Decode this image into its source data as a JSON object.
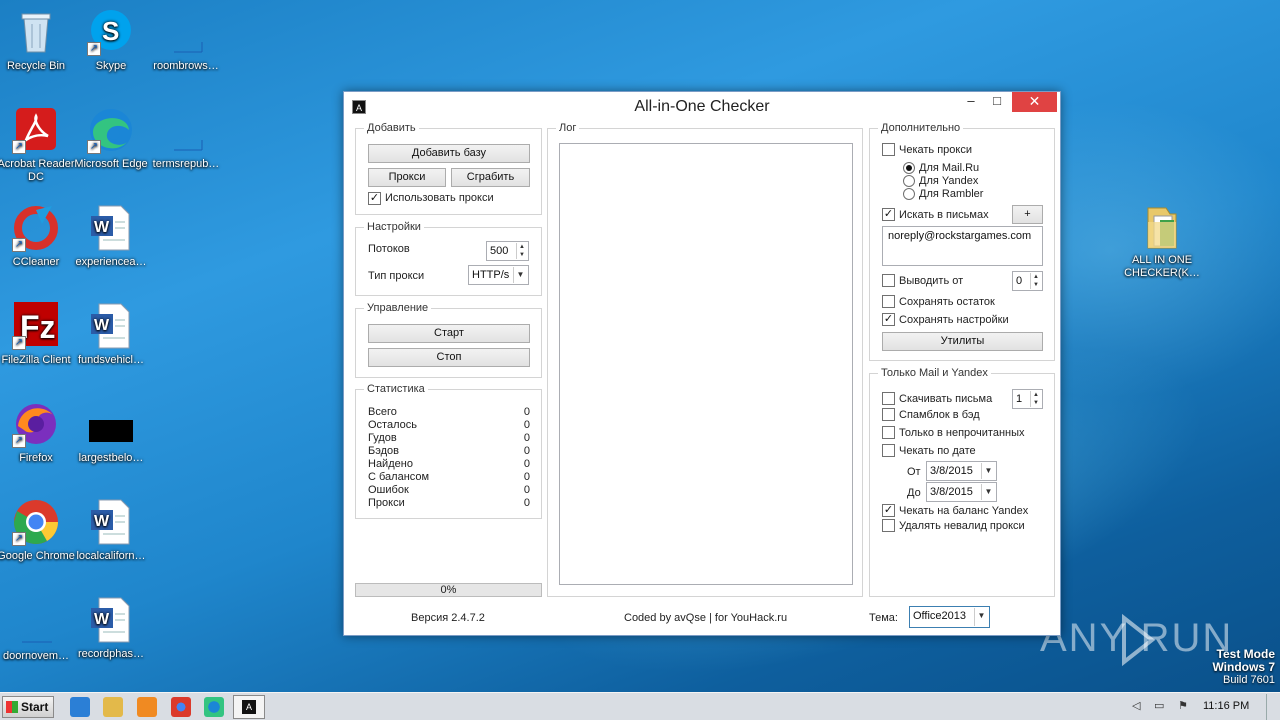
{
  "desktop": {
    "icons": [
      {
        "label": "Recycle Bin",
        "icon": "recycle-bin-icon"
      },
      {
        "label": "Skype",
        "icon": "skype-icon"
      },
      {
        "label": "roombrows…",
        "icon": "blank-file-icon"
      },
      {
        "label": "Acrobat Reader DC",
        "icon": "acrobat-icon"
      },
      {
        "label": "Microsoft Edge",
        "icon": "edge-icon"
      },
      {
        "label": "termsrepub…",
        "icon": "blank-file-icon"
      },
      {
        "label": "CCleaner",
        "icon": "ccleaner-icon"
      },
      {
        "label": "experiencea…",
        "icon": "word-doc-icon"
      },
      {
        "label": "FileZilla Client",
        "icon": "filezilla-icon"
      },
      {
        "label": "fundsvehicl…",
        "icon": "word-doc-icon"
      },
      {
        "label": "Firefox",
        "icon": "firefox-icon"
      },
      {
        "label": "largestbelo…",
        "icon": "black-file-icon"
      },
      {
        "label": "Google Chrome",
        "icon": "chrome-icon"
      },
      {
        "label": "localcaliforn…",
        "icon": "word-doc-icon"
      },
      {
        "label": "doornovem…",
        "icon": "blank-file-icon"
      },
      {
        "label": "recordphas…",
        "icon": "word-doc-icon"
      },
      {
        "label": "ALL IN ONE CHECKER(K…",
        "icon": "folder-icon"
      }
    ]
  },
  "window": {
    "icon_letter": "A",
    "title": "All-in-One Checker",
    "minimize": "–",
    "maximize": "□",
    "close": "✕",
    "add_group": {
      "label": "Добавить",
      "add_base": "Добавить базу",
      "proxy": "Прокси",
      "grab": "Сграбить",
      "use_proxy": "Использовать прокси",
      "use_proxy_checked": true
    },
    "settings_group": {
      "label": "Настройки",
      "threads_label": "Потоков",
      "threads_value": "500",
      "proxy_type_label": "Тип прокси",
      "proxy_type_value": "HTTP/s"
    },
    "control_group": {
      "label": "Управление",
      "start": "Старт",
      "stop": "Стоп"
    },
    "stats_group": {
      "label": "Статистика",
      "rows": [
        {
          "name": "Всего",
          "value": "0"
        },
        {
          "name": "Осталось",
          "value": "0"
        },
        {
          "name": "Гудов",
          "value": "0"
        },
        {
          "name": "Бэдов",
          "value": "0"
        },
        {
          "name": "Найдено",
          "value": "0"
        },
        {
          "name": "С балансом",
          "value": "0"
        },
        {
          "name": "Ошибок",
          "value": "0"
        },
        {
          "name": "Прокси",
          "value": "0"
        }
      ]
    },
    "progress": {
      "text": "0%",
      "value": 0
    },
    "log_group": {
      "label": "Лог"
    },
    "extra_group": {
      "label": "Дополнительно",
      "check_proxy": "Чекать прокси",
      "for_mailru": "Для Mail.Ru",
      "for_yandex": "Для Yandex",
      "for_rambler": "Для Rambler",
      "search_in_mails": "Искать в письмах",
      "plus": "+",
      "search_text": "noreply@rockstargames.com",
      "output_from": "Выводить от",
      "output_from_value": "0",
      "save_rest": "Сохранять остаток",
      "save_settings": "Сохранять настройки",
      "utilities": "Утилиты"
    },
    "mail_yandex_group": {
      "label": "Только Mail и Yandex",
      "download_mails": "Скачивать письма",
      "download_value": "1",
      "spamblock": "Спамблок в бэд",
      "only_unread": "Только в непрочитанных",
      "check_by_date": "Чекать по дате",
      "from_label": "От",
      "from_date": "3/8/2015",
      "to_label": "До",
      "to_date": "3/8/2015",
      "check_yandex_balance": "Чекать на баланс Yandex",
      "delete_invalid_proxy": "Удалять невалид прокси"
    },
    "footer": {
      "version": "Версия 2.4.7.2",
      "credits": "Coded by avQse | for YouHack.ru",
      "theme_label": "Тема:",
      "theme_value": "Office2013"
    }
  },
  "watermark": {
    "brand": "ANY RUN",
    "test_mode": "Test Mode",
    "os": "Windows 7",
    "build": "Build 7601"
  },
  "taskbar": {
    "start": "Start",
    "clock": "11:16 PM",
    "active_app_letter": "A"
  }
}
